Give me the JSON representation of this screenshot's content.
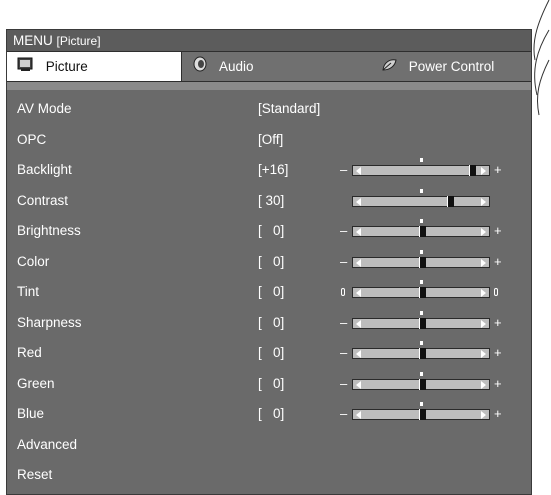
{
  "menu": {
    "title_prefix": "MENU",
    "title_section": "[Picture]"
  },
  "tabs": [
    {
      "label": "Picture",
      "icon": "picture-icon",
      "active": true
    },
    {
      "label": "Audio",
      "icon": "audio-icon",
      "active": false
    },
    {
      "label": "Power Control",
      "icon": "leaf-icon",
      "active": false
    }
  ],
  "rows": [
    {
      "label": "AV Mode",
      "value": "[Standard]"
    },
    {
      "label": "OPC",
      "value": "[Off]"
    },
    {
      "label": "Backlight",
      "value": "[+16]",
      "level": 0.95,
      "slider": "pm"
    },
    {
      "label": "Contrast",
      "value": "[ 30]",
      "level": 0.75,
      "slider": "none"
    },
    {
      "label": "Brightness",
      "value": "[   0]",
      "level": 0.5,
      "slider": "pm"
    },
    {
      "label": "Color",
      "value": "[   0]",
      "level": 0.5,
      "slider": "pm"
    },
    {
      "label": "Tint",
      "value": "[   0]",
      "level": 0.5,
      "slider": "tint"
    },
    {
      "label": "Sharpness",
      "value": "[   0]",
      "level": 0.5,
      "slider": "pm"
    },
    {
      "label": "Red",
      "value": "[   0]",
      "level": 0.5,
      "slider": "pm"
    },
    {
      "label": "Green",
      "value": "[   0]",
      "level": 0.5,
      "slider": "pm"
    },
    {
      "label": "Blue",
      "value": "[   0]",
      "level": 0.5,
      "slider": "pm"
    },
    {
      "label": "Advanced",
      "value": ""
    },
    {
      "label": "Reset",
      "value": ""
    }
  ],
  "symbols": {
    "minus": "–",
    "plus": "+"
  },
  "colors": {
    "panel": "#6a6a6a",
    "titlebar": "#5c5c5c",
    "active_tab": "#ffffff"
  }
}
